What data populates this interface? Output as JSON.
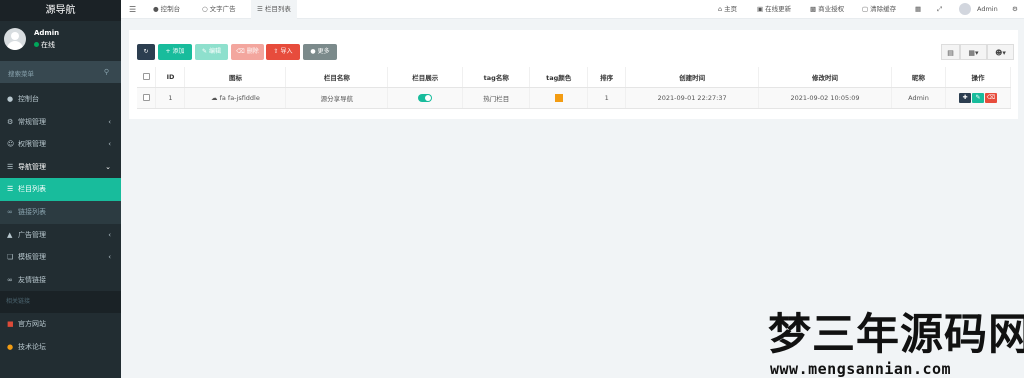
{
  "app": {
    "brand": "源导航"
  },
  "user": {
    "name": "Admin",
    "status": "在线"
  },
  "search": {
    "placeholder": "搜索菜单"
  },
  "sidebar": {
    "items": [
      {
        "label": "控制台",
        "icon": "dashboard-icon"
      },
      {
        "label": "常规管理",
        "icon": "cogs-icon"
      },
      {
        "label": "权限管理",
        "icon": "group-icon"
      },
      {
        "label": "导航管理",
        "icon": "list-icon"
      },
      {
        "label": "栏目列表",
        "icon": "list-icon"
      },
      {
        "label": "链接列表",
        "icon": "link-icon"
      },
      {
        "label": "广告管理",
        "icon": "car-icon"
      },
      {
        "label": "模板管理",
        "icon": "clone-icon"
      },
      {
        "label": "友情链接",
        "icon": "link-icon"
      },
      {
        "label": "相关链接"
      },
      {
        "label": "官方网站",
        "icon": "flag-icon",
        "color": "#dd4b39"
      },
      {
        "label": "技术论坛",
        "icon": "comment-icon",
        "color": "#f39c12"
      }
    ]
  },
  "topbar": {
    "tabs": [
      {
        "label": "控制台",
        "icon": "dashboard-icon"
      },
      {
        "label": "文字广告",
        "icon": "circle-icon"
      },
      {
        "label": "栏目列表",
        "icon": "list-icon"
      }
    ],
    "right": [
      {
        "label": "主页",
        "icon": "home-icon"
      },
      {
        "label": "在线更新",
        "icon": "update-icon"
      },
      {
        "label": "商业授权",
        "icon": "license-icon"
      },
      {
        "label": "清除缓存",
        "icon": "trash-icon"
      },
      {
        "label": "Admin",
        "icon": "avatar"
      }
    ]
  },
  "toolbar": {
    "add": "添加",
    "edit": "编辑",
    "delete": "删除",
    "import": "导入",
    "more": "更多"
  },
  "table": {
    "headers": [
      "ID",
      "图标",
      "栏目名称",
      "栏目展示",
      "tag名称",
      "tag颜色",
      "排序",
      "创建时间",
      "修改时间",
      "昵称",
      "操作"
    ],
    "rows": [
      {
        "id": "1",
        "icon": "fa fa-jsfiddle",
        "name": "源分享导航",
        "show": true,
        "tag_name": "热门栏目",
        "tag_color": "#f39c12",
        "sort": "1",
        "created": "2021-09-01 22:27:37",
        "updated": "2021-09-02 10:05:09",
        "nickname": "Admin"
      }
    ]
  },
  "colors": {
    "accent": "#18bc9c",
    "sidebar": "#222d32",
    "danger": "#e74c3c",
    "dark": "#2c3e50"
  },
  "watermark": {
    "line1": "梦三年源码网",
    "line2": "www.mengsannian.com"
  }
}
